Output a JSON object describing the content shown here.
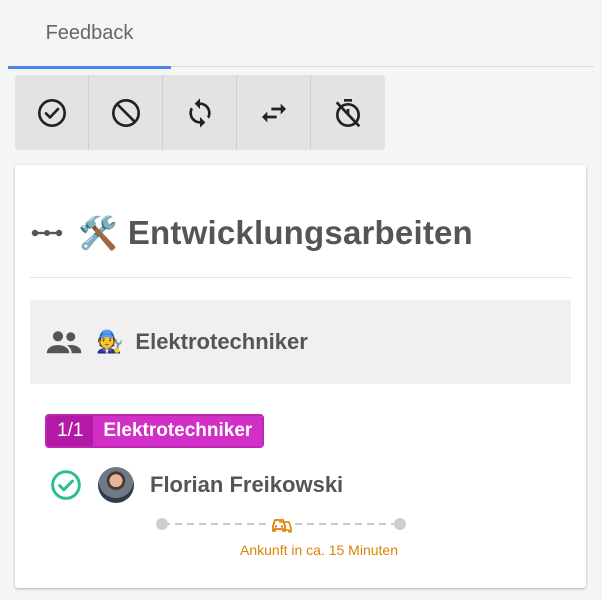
{
  "tabs": [
    {
      "label": "Feedback",
      "active": true
    }
  ],
  "toolbar": {
    "buttons": [
      {
        "icon": "check-circle-icon",
        "label": "Bestätigen"
      },
      {
        "icon": "block-icon",
        "label": "Ablehnen"
      },
      {
        "icon": "sync-icon",
        "label": "Aktualisieren"
      },
      {
        "icon": "swap-icon",
        "label": "Tauschen"
      },
      {
        "icon": "timer-off-icon",
        "label": "Timer aus"
      }
    ]
  },
  "card": {
    "title_emoji": "🛠️",
    "title": "Entwicklungsarbeiten",
    "group": {
      "emoji": "🧑‍🔧",
      "label": "Elektrotechniker"
    },
    "role_badge": {
      "count": "1/1",
      "name": "Elektrotechniker",
      "color": "#d22fc6"
    },
    "person": {
      "name": "Florian Freikowski",
      "status": "confirmed",
      "status_color": "#2bbf8a"
    },
    "eta": {
      "text": "Ankunft in ca. 15 Minuten",
      "color": "#d98400"
    }
  },
  "colors": {
    "accent": "#4a86e8",
    "badge": "#d22fc6",
    "success": "#2bbf8a",
    "eta": "#d98400"
  }
}
